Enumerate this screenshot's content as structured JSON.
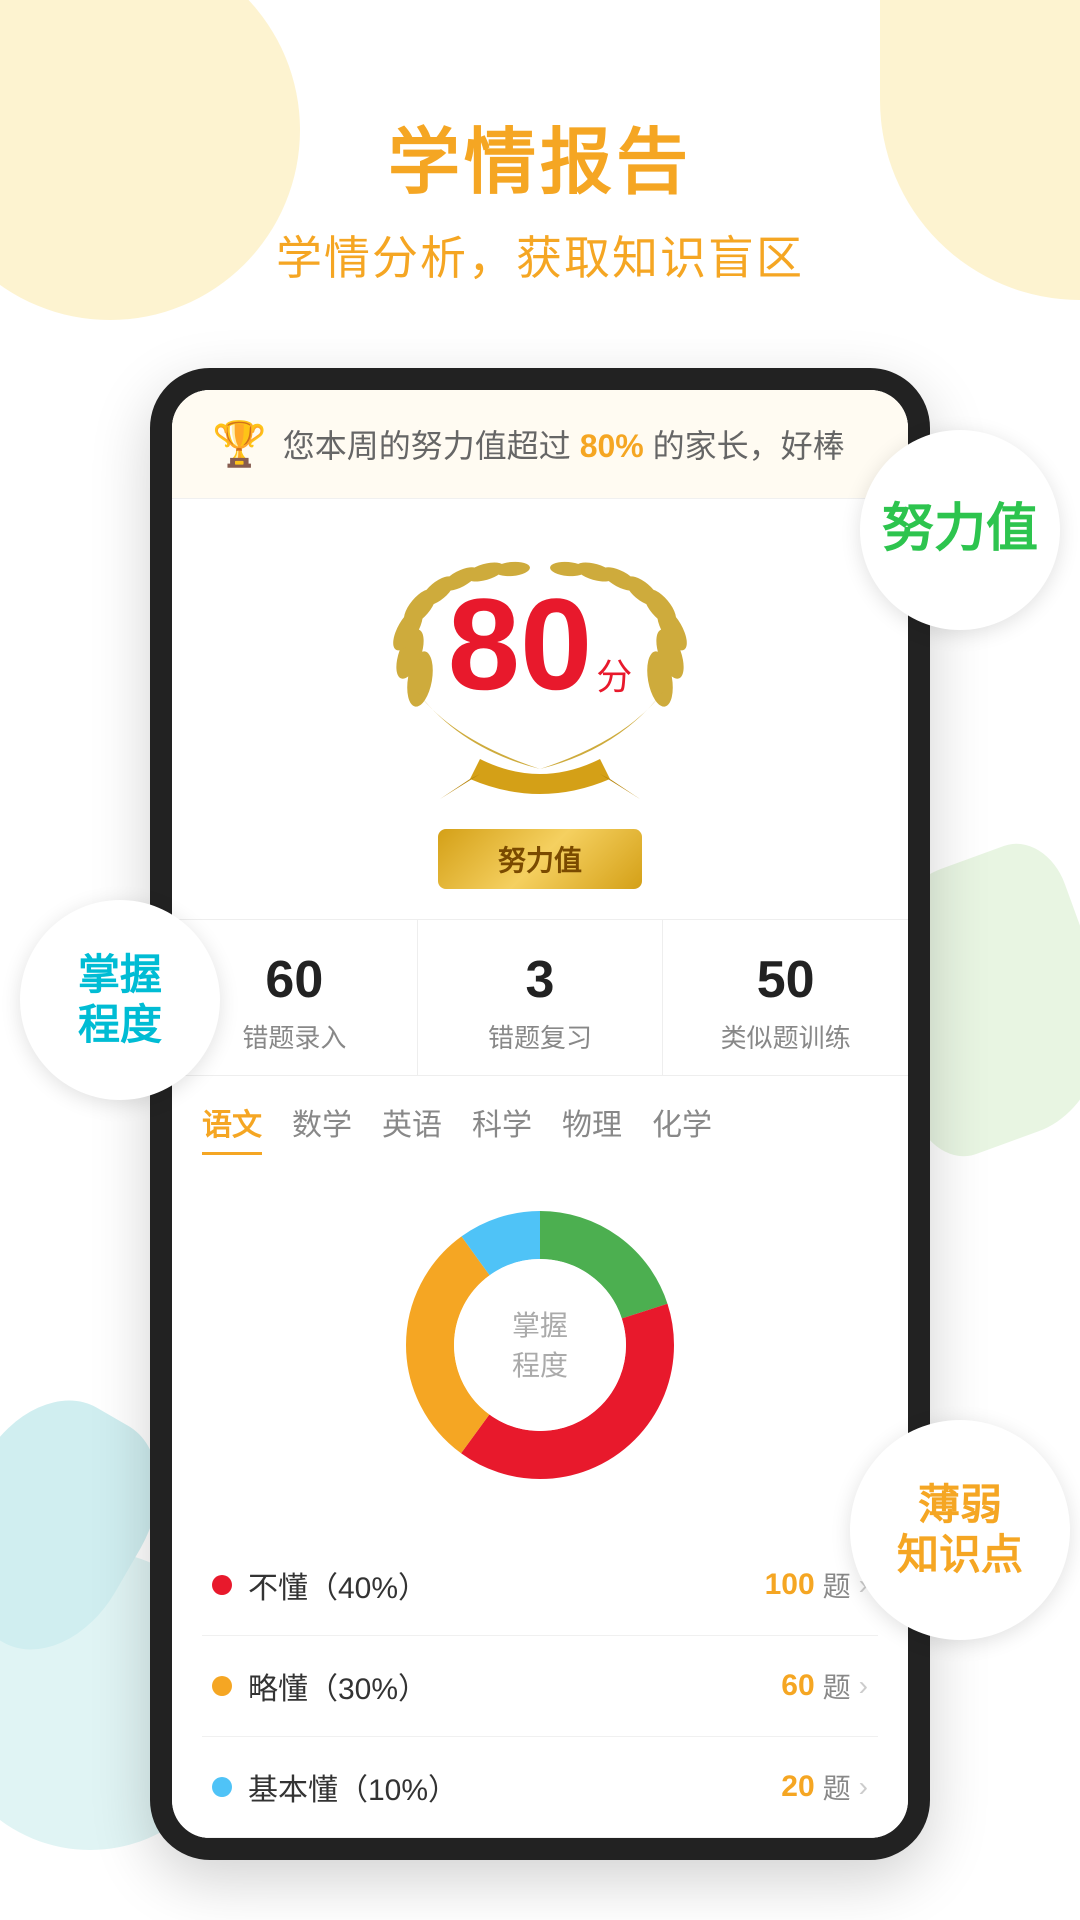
{
  "header": {
    "title": "学情报告",
    "subtitle": "学情分析，获取知识盲区"
  },
  "phone": {
    "banner": {
      "trophy": "🏆",
      "text_before": "您本周的努力值超过",
      "highlight": "80%",
      "text_after": "的家长，好棒"
    },
    "score": {
      "number": "80",
      "unit": "分",
      "label": "努力值"
    },
    "stats": [
      {
        "number": "60",
        "label": "错题录入"
      },
      {
        "number": "3",
        "label": "错题复习"
      },
      {
        "number": "50",
        "label": "类似题训练"
      }
    ],
    "subjects": [
      {
        "label": "语文",
        "active": true
      },
      {
        "label": "数学",
        "active": false
      },
      {
        "label": "英语",
        "active": false
      },
      {
        "label": "科学",
        "active": false
      },
      {
        "label": "物理",
        "active": false
      },
      {
        "label": "化学",
        "active": false
      }
    ],
    "chart": {
      "center_label": "掌握\n程度",
      "segments": [
        {
          "label": "不懂（40%）",
          "color": "#e8192c",
          "pct": 40
        },
        {
          "label": "略懂（30%）",
          "color": "#f5a623",
          "pct": 30
        },
        {
          "label": "基本懂（10%）",
          "color": "#4fc3f7",
          "pct": 10
        },
        {
          "label": "掌握",
          "color": "#4caf50",
          "pct": 20
        }
      ]
    },
    "mastery_items": [
      {
        "label": "不懂（40%）",
        "dot_color": "#e8192c",
        "count": "100",
        "unit": "题"
      },
      {
        "label": "略懂（30%）",
        "dot_color": "#f5a623",
        "count": "60",
        "unit": "题"
      },
      {
        "label": "基本懂（10%）",
        "dot_color": "#4fc3f7",
        "count": "20",
        "unit": "题"
      }
    ]
  },
  "float_labels": {
    "nuli": "努力值",
    "zhangwo": "掌握\n程度",
    "ruodian": "薄弱\n知识点"
  }
}
